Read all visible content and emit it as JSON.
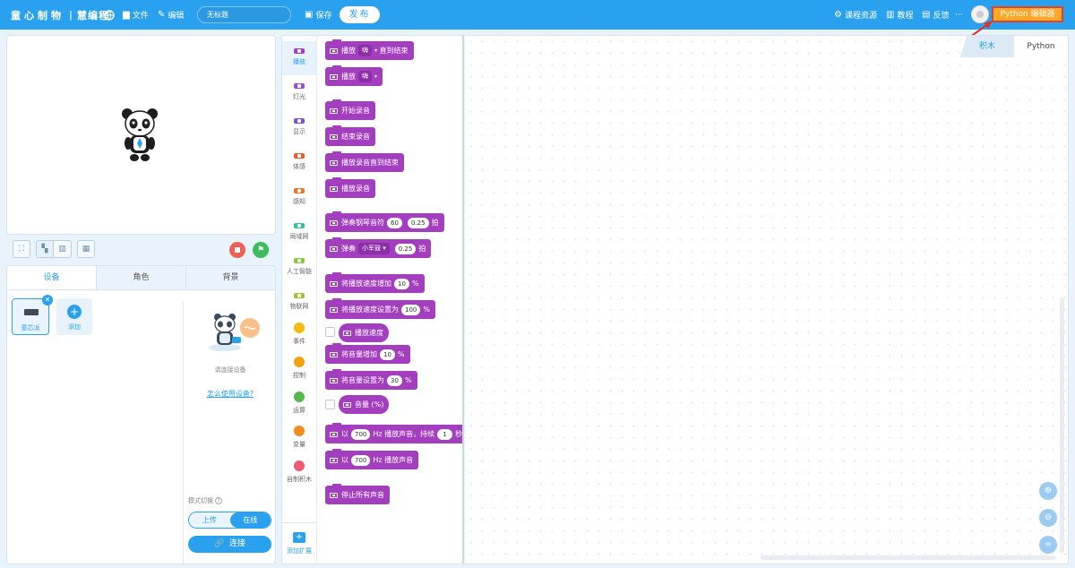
{
  "header": {
    "brand": "童心制物",
    "product": "慧编程",
    "file_label": "文件",
    "edit_label": "编辑",
    "project_title": "无标题",
    "save_label": "保存",
    "publish_label": "发布",
    "course_label": "课程资源",
    "tutorial_label": "教程",
    "feedback_label": "反馈",
    "more_label": "···",
    "python_editor_label": "Python 编辑器"
  },
  "stage": {
    "sprite_icon": "panda-sprite"
  },
  "device_panel": {
    "tabs": [
      "设备",
      "角色",
      "背景"
    ],
    "active_tab": "设备",
    "device_name": "童芯派",
    "add_label": "添加",
    "connect_hint": "请连接设备",
    "how_to_link": "怎么使用设备?",
    "mode_label": "模式切换",
    "mode_upload": "上传",
    "mode_live": "在线",
    "connect_label": "连接"
  },
  "categories": [
    {
      "label": "播放",
      "color": "#a33ebf",
      "shape": "pill"
    },
    {
      "label": "灯光",
      "color": "#9b4dd6",
      "shape": "pill"
    },
    {
      "label": "显示",
      "color": "#7a53c9",
      "shape": "pill"
    },
    {
      "label": "体感",
      "color": "#e85d2a",
      "shape": "pill"
    },
    {
      "label": "感知",
      "color": "#e7772b",
      "shape": "pill"
    },
    {
      "label": "局域网",
      "color": "#2ebfa6",
      "shape": "pill"
    },
    {
      "label": "人工智能",
      "color": "#86c83d",
      "shape": "pill"
    },
    {
      "label": "物联网",
      "color": "#a0c230",
      "shape": "pill"
    },
    {
      "label": "事件",
      "color": "#f5b90f",
      "shape": "dot"
    },
    {
      "label": "控制",
      "color": "#f5a00f",
      "shape": "dot"
    },
    {
      "label": "运算",
      "color": "#58b74f",
      "shape": "dot"
    },
    {
      "label": "变量",
      "color": "#f08c1f",
      "shape": "dot"
    },
    {
      "label": "自制积木",
      "color": "#ee5a74",
      "shape": "dot"
    }
  ],
  "add_extension_label": "添加扩展",
  "blocks": {
    "b1_pre": "播放",
    "b1_dd": "嗨",
    "b1_post": "直到结束",
    "b2_pre": "播放",
    "b2_dd": "嗨",
    "b3": "开始录音",
    "b4": "结束录音",
    "b5": "播放录音直到结束",
    "b6": "播放录音",
    "b7_pre": "弹奏钢琴音符",
    "b7_v1": "60",
    "b7_v2": "0.25",
    "b7_post": "拍",
    "b8_pre": "弹奏",
    "b8_dd": "小军鼓",
    "b8_v": "0.25",
    "b8_post": "拍",
    "b9_pre": "将播放速度增加",
    "b9_v": "10",
    "b9_post": "%",
    "b10_pre": "将播放速度设置为",
    "b10_v": "100",
    "b10_post": "%",
    "b11": "播放速度",
    "b12_pre": "将音量增加",
    "b12_v": "10",
    "b12_post": "%",
    "b13_pre": "将音量设置为",
    "b13_v": "30",
    "b13_post": "%",
    "b14": "音量 (%)",
    "b15_pre": "以",
    "b15_v1": "700",
    "b15_mid": "Hz 播放声音，持续",
    "b15_v2": "1",
    "b15_post": "秒",
    "b16_pre": "以",
    "b16_v": "700",
    "b16_post": "Hz 播放声音",
    "b17": "停止所有声音"
  },
  "workspace": {
    "tab_blocks": "积木",
    "tab_python": "Python"
  },
  "colors": {
    "primary": "#2aa1ef",
    "sound_block": "#a33ebf",
    "python_button": "#ffa826",
    "highlight_border": "#e0402e"
  }
}
